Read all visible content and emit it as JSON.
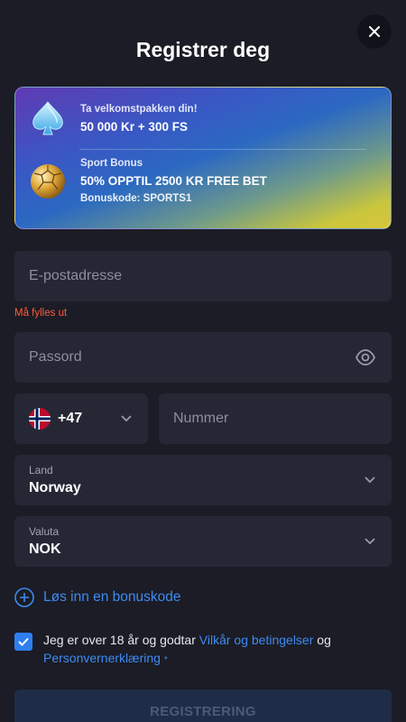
{
  "header": {
    "title": "Registrer deg"
  },
  "promo": {
    "welcome": {
      "label": "Ta velkomstpakken din!",
      "offer": "50 000 Kr + 300 FS",
      "icon": "spade-icon"
    },
    "sport": {
      "label": "Sport Bonus",
      "offer": "50% OPPTIL 2500 KR FREE BET",
      "code_label": "Bonuskode:",
      "code_value": "SPORTS1",
      "icon": "football-icon"
    }
  },
  "form": {
    "email": {
      "placeholder": "E-postadresse",
      "error": "Må fylles ut"
    },
    "password": {
      "placeholder": "Passord"
    },
    "phone": {
      "prefix": "+47",
      "placeholder": "Nummer"
    },
    "country": {
      "label": "Land",
      "value": "Norway"
    },
    "currency": {
      "label": "Valuta",
      "value": "NOK"
    },
    "bonus_link": "Løs inn en bonuskode",
    "terms": {
      "text1": "Jeg er over 18 år og godtar",
      "link1": "Vilkår og betingelser",
      "text2": "og",
      "link2": "Personvernerklæring",
      "required_mark": "*",
      "checked": true
    },
    "submit": "REGISTRERING"
  },
  "colors": {
    "accent": "#3d8bf2",
    "error": "#ff5a3c",
    "background": "#1b1c25",
    "field": "#262735"
  }
}
